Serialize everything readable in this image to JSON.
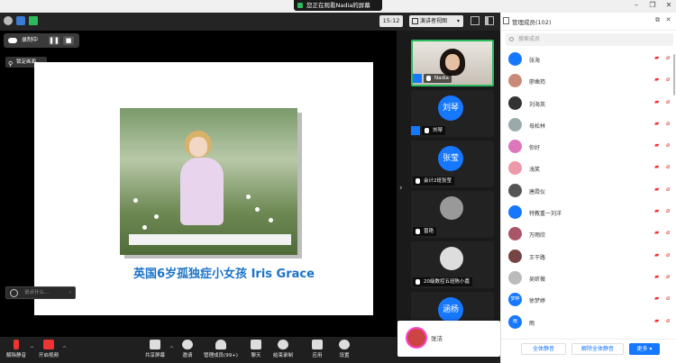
{
  "titlebar": {
    "viewing": "您正在观看Nadia的屏幕"
  },
  "infobar": {
    "timer": "15:12",
    "view_label": "演讲者视图"
  },
  "recording": {
    "label": "录制中",
    "pin_tip": "锁定画面"
  },
  "slide": {
    "caption": "英国6岁孤独症小女孩 Iris Grace"
  },
  "chat": {
    "placeholder": "说点什么..."
  },
  "gallery": [
    {
      "name": "Nadia",
      "kind": "video",
      "avatar_text": ""
    },
    {
      "name": "刘琴",
      "kind": "avatar",
      "avatar_text": "刘琴"
    },
    {
      "name": "会计2班张莹",
      "kind": "avatar",
      "avatar_text": "张莹"
    },
    {
      "name": "曾艳",
      "kind": "photo",
      "avatar_text": ""
    },
    {
      "name": "20级数控五班陈小嘉",
      "kind": "photo",
      "avatar_text": ""
    },
    {
      "name": "",
      "kind": "avatar",
      "avatar_text": "涵杨"
    }
  ],
  "toolbar": [
    {
      "label": "解除静音",
      "icon": "mic-muted-icon",
      "color": "#e33"
    },
    {
      "label": "开启视频",
      "icon": "video-off-icon",
      "color": "#e33"
    },
    {
      "label": "共享屏幕",
      "icon": "share-screen-icon",
      "color": "#ddd"
    },
    {
      "label": "邀请",
      "icon": "invite-icon",
      "color": "#ddd"
    },
    {
      "label": "管理成员(99+)",
      "icon": "members-icon",
      "color": "#ddd"
    },
    {
      "label": "聊天",
      "icon": "chat-icon",
      "color": "#ddd"
    },
    {
      "label": "结束录制",
      "icon": "stop-record-icon",
      "color": "#ddd"
    },
    {
      "label": "应用",
      "icon": "apps-icon",
      "color": "#ddd"
    },
    {
      "label": "设置",
      "icon": "gear-icon",
      "color": "#ddd"
    }
  ],
  "selfview": {
    "name": "张洁"
  },
  "panel": {
    "title": "管理成员(102)",
    "search_placeholder": "搜索成员",
    "members": [
      {
        "name": "张海",
        "avatar_color": "#1677ff",
        "avatar_text": ""
      },
      {
        "name": "廖凿筠",
        "avatar_color": "#c98a7a",
        "avatar_text": ""
      },
      {
        "name": "刘海英",
        "avatar_color": "#333",
        "avatar_text": ""
      },
      {
        "name": "母松林",
        "avatar_color": "#9aa",
        "avatar_text": ""
      },
      {
        "name": "你好",
        "avatar_color": "#d7b",
        "avatar_text": ""
      },
      {
        "name": "浅笑",
        "avatar_color": "#e9a",
        "avatar_text": ""
      },
      {
        "name": "唐霞仪",
        "avatar_color": "#555",
        "avatar_text": ""
      },
      {
        "name": "特教重一刘洋",
        "avatar_color": "#1677ff",
        "avatar_text": ""
      },
      {
        "name": "万雨欣",
        "avatar_color": "#a56",
        "avatar_text": ""
      },
      {
        "name": "王干路",
        "avatar_color": "#744",
        "avatar_text": ""
      },
      {
        "name": "吴昕薇",
        "avatar_color": "#bbb",
        "avatar_text": ""
      },
      {
        "name": "徐梦婷",
        "avatar_color": "#1677ff",
        "avatar_text": "梦婷"
      },
      {
        "name": "雨",
        "avatar_color": "#1677ff",
        "avatar_text": "雨"
      }
    ],
    "mute_all": "全体静音",
    "unmute_all": "解除全体静音",
    "more": "更多 ▾"
  }
}
